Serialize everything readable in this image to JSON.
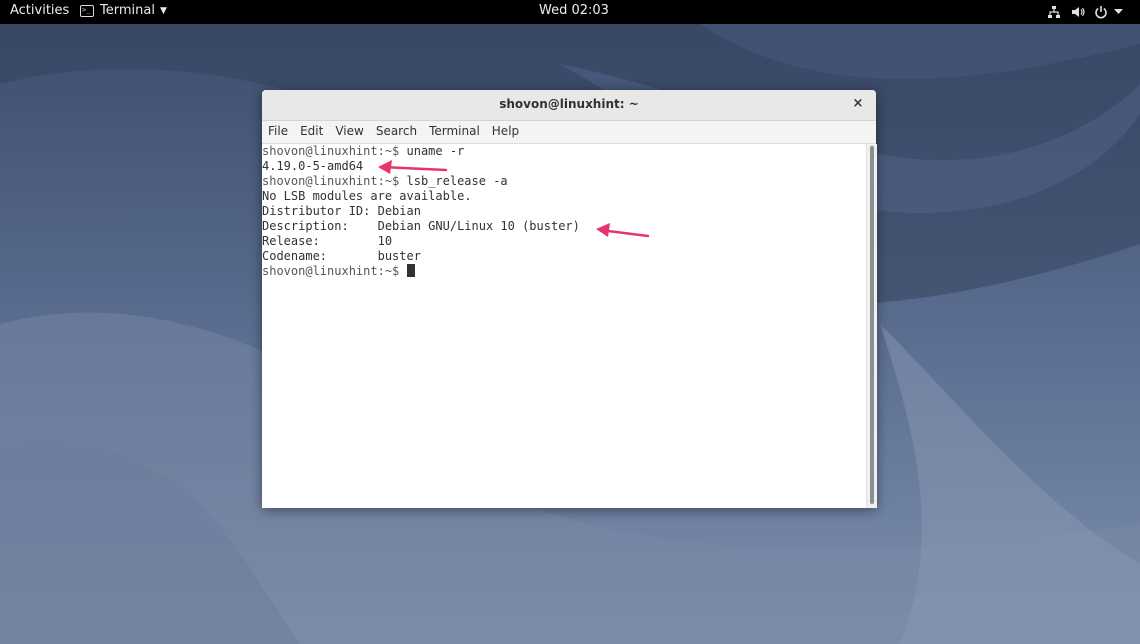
{
  "topbar": {
    "activities_label": "Activities",
    "app_menu_label": "Terminal",
    "clock": "Wed 02:03",
    "tray_icons": [
      "network-icon",
      "volume-icon",
      "power-icon"
    ]
  },
  "window": {
    "title": "shovon@linuxhint: ~",
    "close_glyph": "×",
    "menu": [
      "File",
      "Edit",
      "View",
      "Search",
      "Terminal",
      "Help"
    ]
  },
  "terminal": {
    "lines": [
      {
        "prompt": "shovon@linuxhint:~$ ",
        "text": "uname -r"
      },
      {
        "prompt": "",
        "text": "4.19.0-5-amd64"
      },
      {
        "prompt": "shovon@linuxhint:~$ ",
        "text": "lsb_release -a"
      },
      {
        "prompt": "",
        "text": "No LSB modules are available."
      },
      {
        "prompt": "",
        "text": "Distributor ID: Debian"
      },
      {
        "prompt": "",
        "text": "Description:    Debian GNU/Linux 10 (buster)"
      },
      {
        "prompt": "",
        "text": "Release:        10"
      },
      {
        "prompt": "",
        "text": "Codename:       buster"
      },
      {
        "prompt": "shovon@linuxhint:~$ ",
        "text": ""
      }
    ]
  },
  "colors": {
    "topbar_bg": "#000000",
    "wallpaper_base": "#5d6f8f",
    "annotation_arrow": "#e8336b"
  }
}
